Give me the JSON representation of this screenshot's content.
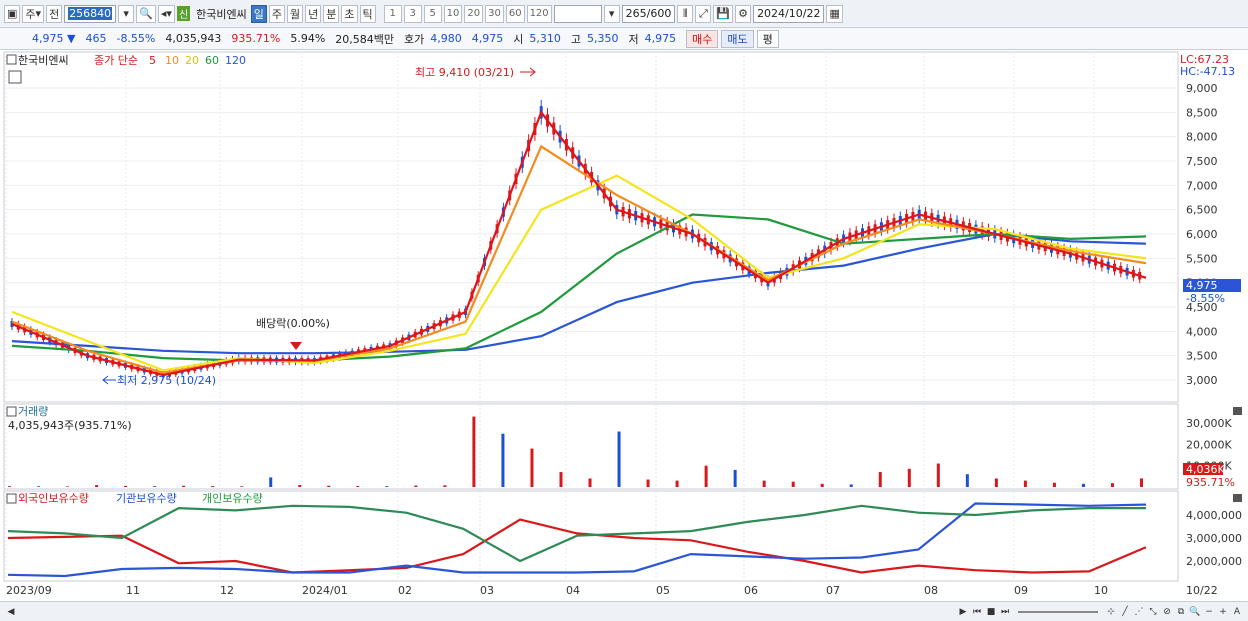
{
  "toolbar": {
    "type_label": "주",
    "prev_label": "전",
    "code": "256840",
    "new_badge": "신",
    "stock_name": "한국비엔씨",
    "periods": [
      "일",
      "주",
      "월",
      "년",
      "분",
      "초",
      "틱"
    ],
    "intervals": [
      "1",
      "3",
      "5",
      "10",
      "20",
      "30",
      "60",
      "120"
    ],
    "count": "265",
    "count_total": "/600",
    "date": "2024/10/22"
  },
  "quote": {
    "price": "4,975",
    "change": "465",
    "change_pct": "-8.55%",
    "volume": "4,035,943",
    "volume_ratio": "935.71%",
    "turnover_pct": "5.94%",
    "value": "20,584백만",
    "ask_label": "호가",
    "ask": "4,980",
    "bid": "4,975",
    "open_label": "시",
    "open": "5,310",
    "high_label": "고",
    "high": "5,350",
    "low_label": "저",
    "low": "4,975",
    "buy_label": "매수",
    "sell_label": "매도",
    "avg_label": "평"
  },
  "price_panel": {
    "stock_name": "한국비엔씨",
    "ma_label": "종가 단순",
    "ma_periods": [
      "5",
      "10",
      "20",
      "60",
      "120"
    ],
    "lc_label": "LC:67.23",
    "hc_label": "HC:-47.13",
    "high_note": "최고 9,410 (03/21)",
    "low_note": "최저 2,975 (10/24)",
    "dividend_note": "배당락(0.00%)",
    "last_price": "4,975",
    "last_change": "-8.55%"
  },
  "volume_panel": {
    "title": "거래량",
    "value_text": "4,035,943주(935.71%)",
    "last_volume": "4,036K",
    "last_ratio": "935.71%"
  },
  "holdings_panel": {
    "foreign_label": "외국인보유수량",
    "inst_label": "기관보유수량",
    "indiv_label": "개인보유수량"
  },
  "colors": {
    "ma5": "#e0141c",
    "ma10": "#f58a1f",
    "ma20": "#f3e51a",
    "ma60": "#1f9a3c",
    "ma120": "#2a55d6",
    "up": "#d8191c",
    "down": "#1b4fd6"
  },
  "x_labels": [
    "2023/09",
    "11",
    "12",
    "2024/01",
    "02",
    "03",
    "04",
    "05",
    "06",
    "07",
    "08",
    "09",
    "10"
  ],
  "x_last_label": "10/22",
  "chart_data": [
    {
      "type": "line",
      "title": "",
      "ylim": [
        2600,
        9400
      ],
      "yticks": [
        "9,000",
        "8,500",
        "8,000",
        "7,500",
        "7,000",
        "6,500",
        "6,000",
        "5,500",
        "5,000",
        "4,500",
        "4,000",
        "3,500",
        "3,000"
      ],
      "yvalues": [
        9000,
        8500,
        8000,
        7500,
        7000,
        6500,
        6000,
        5500,
        5000,
        4500,
        4000,
        3500,
        3000
      ],
      "x": [
        "2023/09",
        "10",
        "11",
        "12",
        "2024/01",
        "02",
        "03",
        "03/21",
        "04",
        "05",
        "06",
        "07",
        "08",
        "09",
        "10",
        "10/22"
      ],
      "series": [
        {
          "name": "5",
          "values": [
            4150,
            3500,
            3100,
            3420,
            3400,
            3700,
            4400,
            8500,
            6500,
            6000,
            5000,
            5900,
            6400,
            6000,
            5600,
            5100
          ]
        },
        {
          "name": "10",
          "values": [
            4200,
            3600,
            3150,
            3400,
            3400,
            3650,
            4200,
            7800,
            6800,
            6000,
            5050,
            5800,
            6300,
            6000,
            5650,
            5400
          ]
        },
        {
          "name": "20",
          "values": [
            4400,
            3800,
            3200,
            3450,
            3350,
            3600,
            3950,
            6500,
            7200,
            6300,
            5100,
            5500,
            6200,
            6100,
            5700,
            5500
          ]
        },
        {
          "name": "60",
          "values": [
            3700,
            3600,
            3450,
            3400,
            3400,
            3480,
            3650,
            4400,
            5600,
            6400,
            6300,
            5800,
            5900,
            6000,
            5900,
            5950
          ]
        },
        {
          "name": "120",
          "values": [
            3800,
            3700,
            3600,
            3550,
            3550,
            3580,
            3620,
            3900,
            4600,
            5000,
            5200,
            5350,
            5700,
            6000,
            5850,
            5800
          ]
        }
      ]
    },
    {
      "type": "bar",
      "title": "거래량",
      "yticks": [
        "30,000K",
        "20,000K",
        "10,000K"
      ],
      "ylim": [
        0,
        35000
      ],
      "values_k": [
        400,
        350,
        300,
        900,
        500,
        400,
        600,
        450,
        350,
        4500,
        900,
        600,
        500,
        400,
        700,
        800,
        33000,
        25000,
        18000,
        7000,
        4000,
        26000,
        3500,
        3000,
        10000,
        8000,
        3000,
        2500,
        1500,
        1200,
        7000,
        8500,
        11000,
        6000,
        4000,
        3000,
        2000,
        1500,
        1800,
        4036
      ]
    },
    {
      "type": "line",
      "title": "",
      "yticks": [
        "4,000,000",
        "3,000,000",
        "2,000,000"
      ],
      "ylim": [
        1200000,
        4800000
      ],
      "series": [
        {
          "name": "외국인보유수량",
          "values": [
            3000000,
            3050000,
            3100000,
            1900000,
            2000000,
            1500000,
            1600000,
            1700000,
            2300000,
            3800000,
            3200000,
            3000000,
            2900000,
            2400000,
            2000000,
            1500000,
            1800000,
            1600000,
            1500000,
            1550000,
            2600000
          ]
        },
        {
          "name": "기관보유수량",
          "values": [
            1400000,
            1350000,
            1650000,
            1700000,
            1650000,
            1500000,
            1500000,
            1800000,
            1500000,
            1500000,
            1500000,
            1550000,
            2300000,
            2200000,
            2100000,
            2150000,
            2500000,
            4500000,
            4450000,
            4400000,
            4450000
          ]
        },
        {
          "name": "개인보유수량",
          "values": [
            3300000,
            3200000,
            3000000,
            4300000,
            4200000,
            4400000,
            4350000,
            4100000,
            3400000,
            2000000,
            3100000,
            3200000,
            3300000,
            3700000,
            4000000,
            4400000,
            4100000,
            4000000,
            4200000,
            4300000,
            4300000
          ]
        }
      ]
    }
  ]
}
